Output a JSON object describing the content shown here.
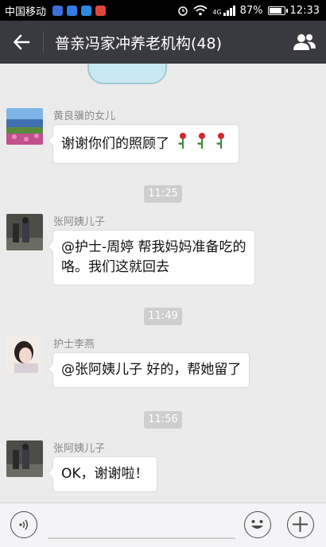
{
  "status_bar": {
    "carrier": "中国移动",
    "network": "4G",
    "battery": "87%",
    "time": "12:33"
  },
  "header": {
    "title": "普亲冯家冲养老机构(48)"
  },
  "messages": [
    {
      "sender": "黄良骥的女儿",
      "text": "谢谢你们的照顾了"
    },
    {
      "time": "11:25"
    },
    {
      "sender": "张阿姨儿子",
      "line1": "@护士-周婷 帮我妈妈准备吃的",
      "line2": "咯。我们这就回去"
    },
    {
      "time": "11:49"
    },
    {
      "sender": "护士李燕",
      "text": "@张阿姨儿子 好的，帮她留了"
    },
    {
      "time": "11:56"
    },
    {
      "sender": "张阿姨儿子",
      "text": "OK，谢谢啦！"
    }
  ],
  "icons": {
    "back": "arrow-left-icon",
    "group": "people-icon",
    "voice": "voice-icon",
    "emoji": "smiley-icon",
    "more": "plus-icon",
    "rose": "rose-emoji"
  },
  "colors": {
    "header_bg": "#393a3f",
    "chat_bg": "#ebebeb",
    "bubble": "#ffffff"
  }
}
